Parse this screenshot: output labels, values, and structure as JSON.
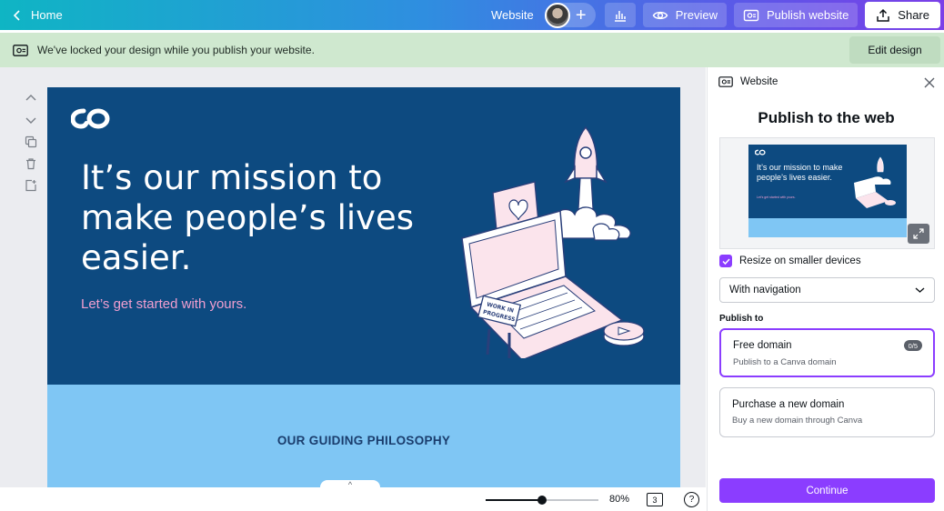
{
  "topbar": {
    "home_label": "Home",
    "design_title": "Website",
    "plus_label": "+",
    "preview_label": "Preview",
    "publish_label": "Publish website",
    "share_label": "Share"
  },
  "banner": {
    "message": "We've locked your design while you publish your website.",
    "edit_label": "Edit design"
  },
  "canvas": {
    "headline": "It’s our mission to make people’s lives easier.",
    "subheading": "Let’s get started with yours.",
    "illustration_sign": "WORK IN PROGRESS",
    "section_heading": "OUR GUIDING PHILOSOPHY"
  },
  "bottombar": {
    "zoom_value": "80%",
    "zoom_fraction": 0.5,
    "page_count": "3",
    "help_label": "?",
    "collapse_label": "^"
  },
  "panel": {
    "header_label": "Website",
    "title": "Publish to the web",
    "preview_headline": "It’s our mission to make people’s lives easier.",
    "preview_sub": "Let’s get started with yours.",
    "resize_label": "Resize on smaller devices",
    "resize_checked": true,
    "navigation_select": "With navigation",
    "publish_to_label": "Publish to",
    "options": [
      {
        "title": "Free domain",
        "description": "Publish to a Canva domain",
        "badge": "0/5",
        "selected": true
      },
      {
        "title": "Purchase a new domain",
        "description": "Buy a new domain through Canva",
        "selected": false
      }
    ],
    "continue_label": "Continue"
  },
  "colors": {
    "accent": "#8b3dff",
    "hero_blue": "#0d4a80",
    "band_blue": "#7fc6f4",
    "banner_green": "#cfe8cf",
    "subheading_pink": "#f29fd0"
  }
}
